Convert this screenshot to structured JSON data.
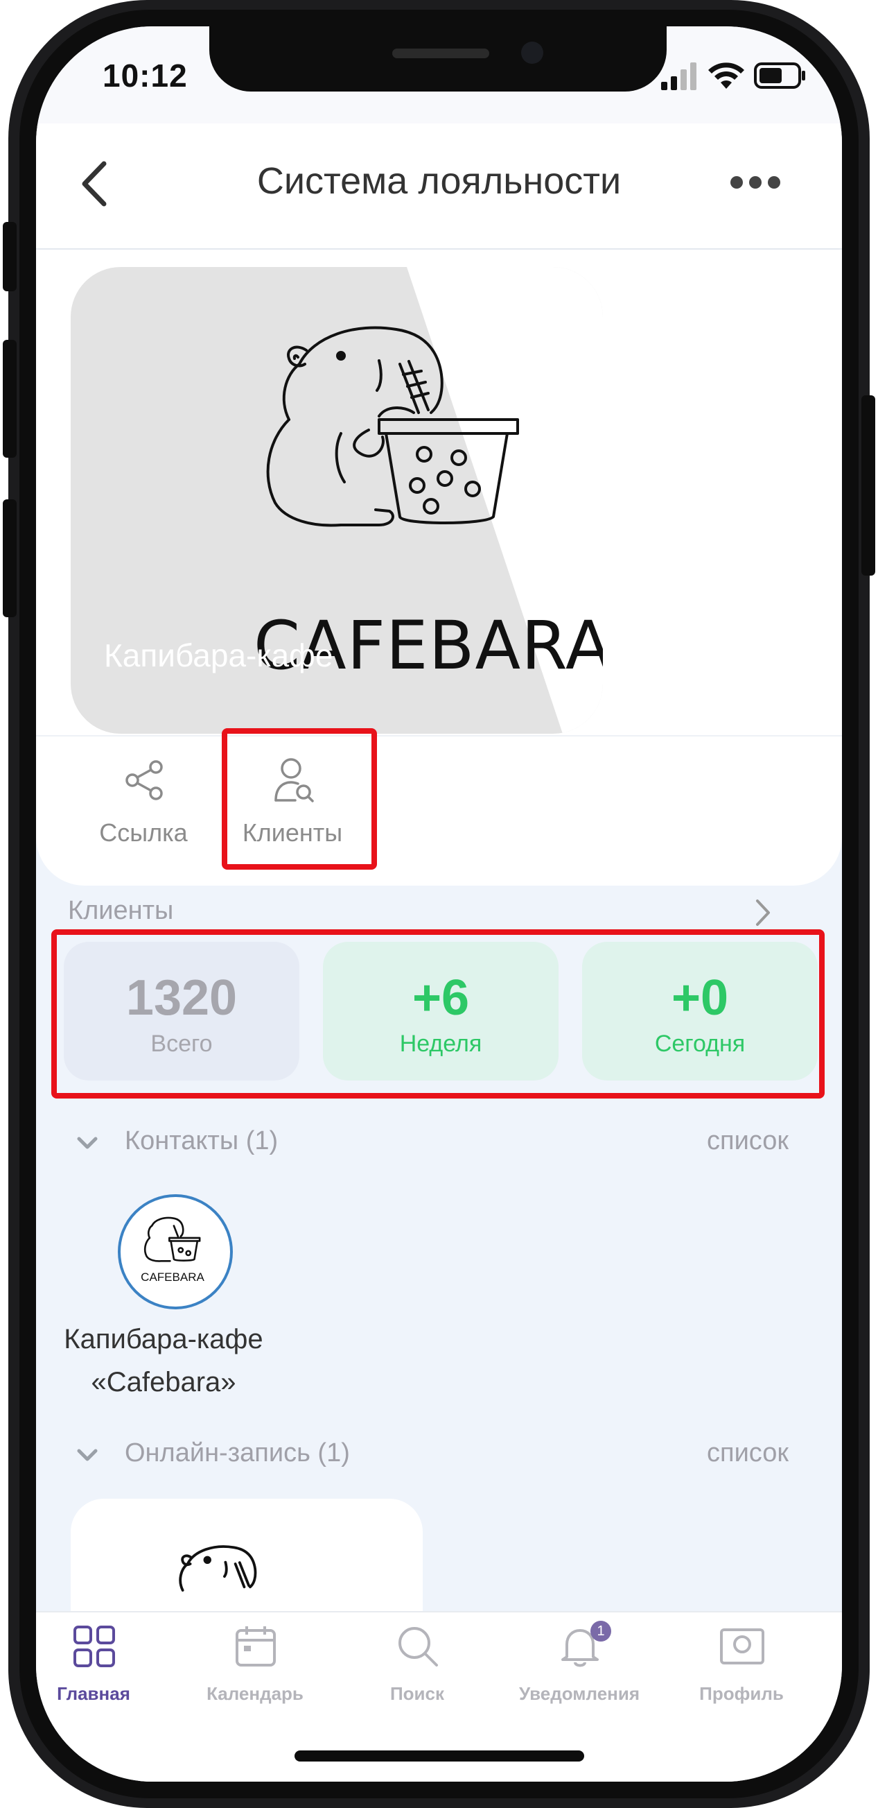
{
  "status_bar": {
    "time": "10:12"
  },
  "header": {
    "title": "Система лояльности",
    "back_icon": "chevron-left-icon",
    "more_icon": "more-dots-icon"
  },
  "hero": {
    "brand": "CAFEBARA",
    "name": "Капибара-кафе"
  },
  "tabs": [
    {
      "label": "Ссылка",
      "icon": "share-icon"
    },
    {
      "label": "Клиенты",
      "icon": "user-search-icon"
    }
  ],
  "clients": {
    "title": "Клиенты",
    "stats": [
      {
        "value": "1320",
        "label": "Всего"
      },
      {
        "value": "+6",
        "label": "Неделя"
      },
      {
        "value": "+0",
        "label": "Сегодня"
      }
    ]
  },
  "contacts": {
    "title": "Контакты (1)",
    "list_link": "список",
    "items": [
      {
        "avatar_text": "CAFEBARA",
        "name_line1": "Капибара-кафе",
        "name_line2": "«Cafebara»"
      }
    ]
  },
  "booking": {
    "title": "Онлайн-запись (1)",
    "list_link": "список"
  },
  "bottom_nav": {
    "items": [
      {
        "label": "Главная",
        "icon": "grid-icon",
        "active": true
      },
      {
        "label": "Календарь",
        "icon": "calendar-icon"
      },
      {
        "label": "Поиск",
        "icon": "search-icon"
      },
      {
        "label": "Уведомления",
        "icon": "bell-icon",
        "badge": "1"
      },
      {
        "label": "Профиль",
        "icon": "profile-card-icon"
      }
    ]
  },
  "colors": {
    "accent_green": "#2dc866",
    "green_bg": "#dff3ec",
    "grey_bg": "#e6ebf5",
    "active_nav": "#5b4a9c",
    "highlight_red": "#e8121a"
  }
}
